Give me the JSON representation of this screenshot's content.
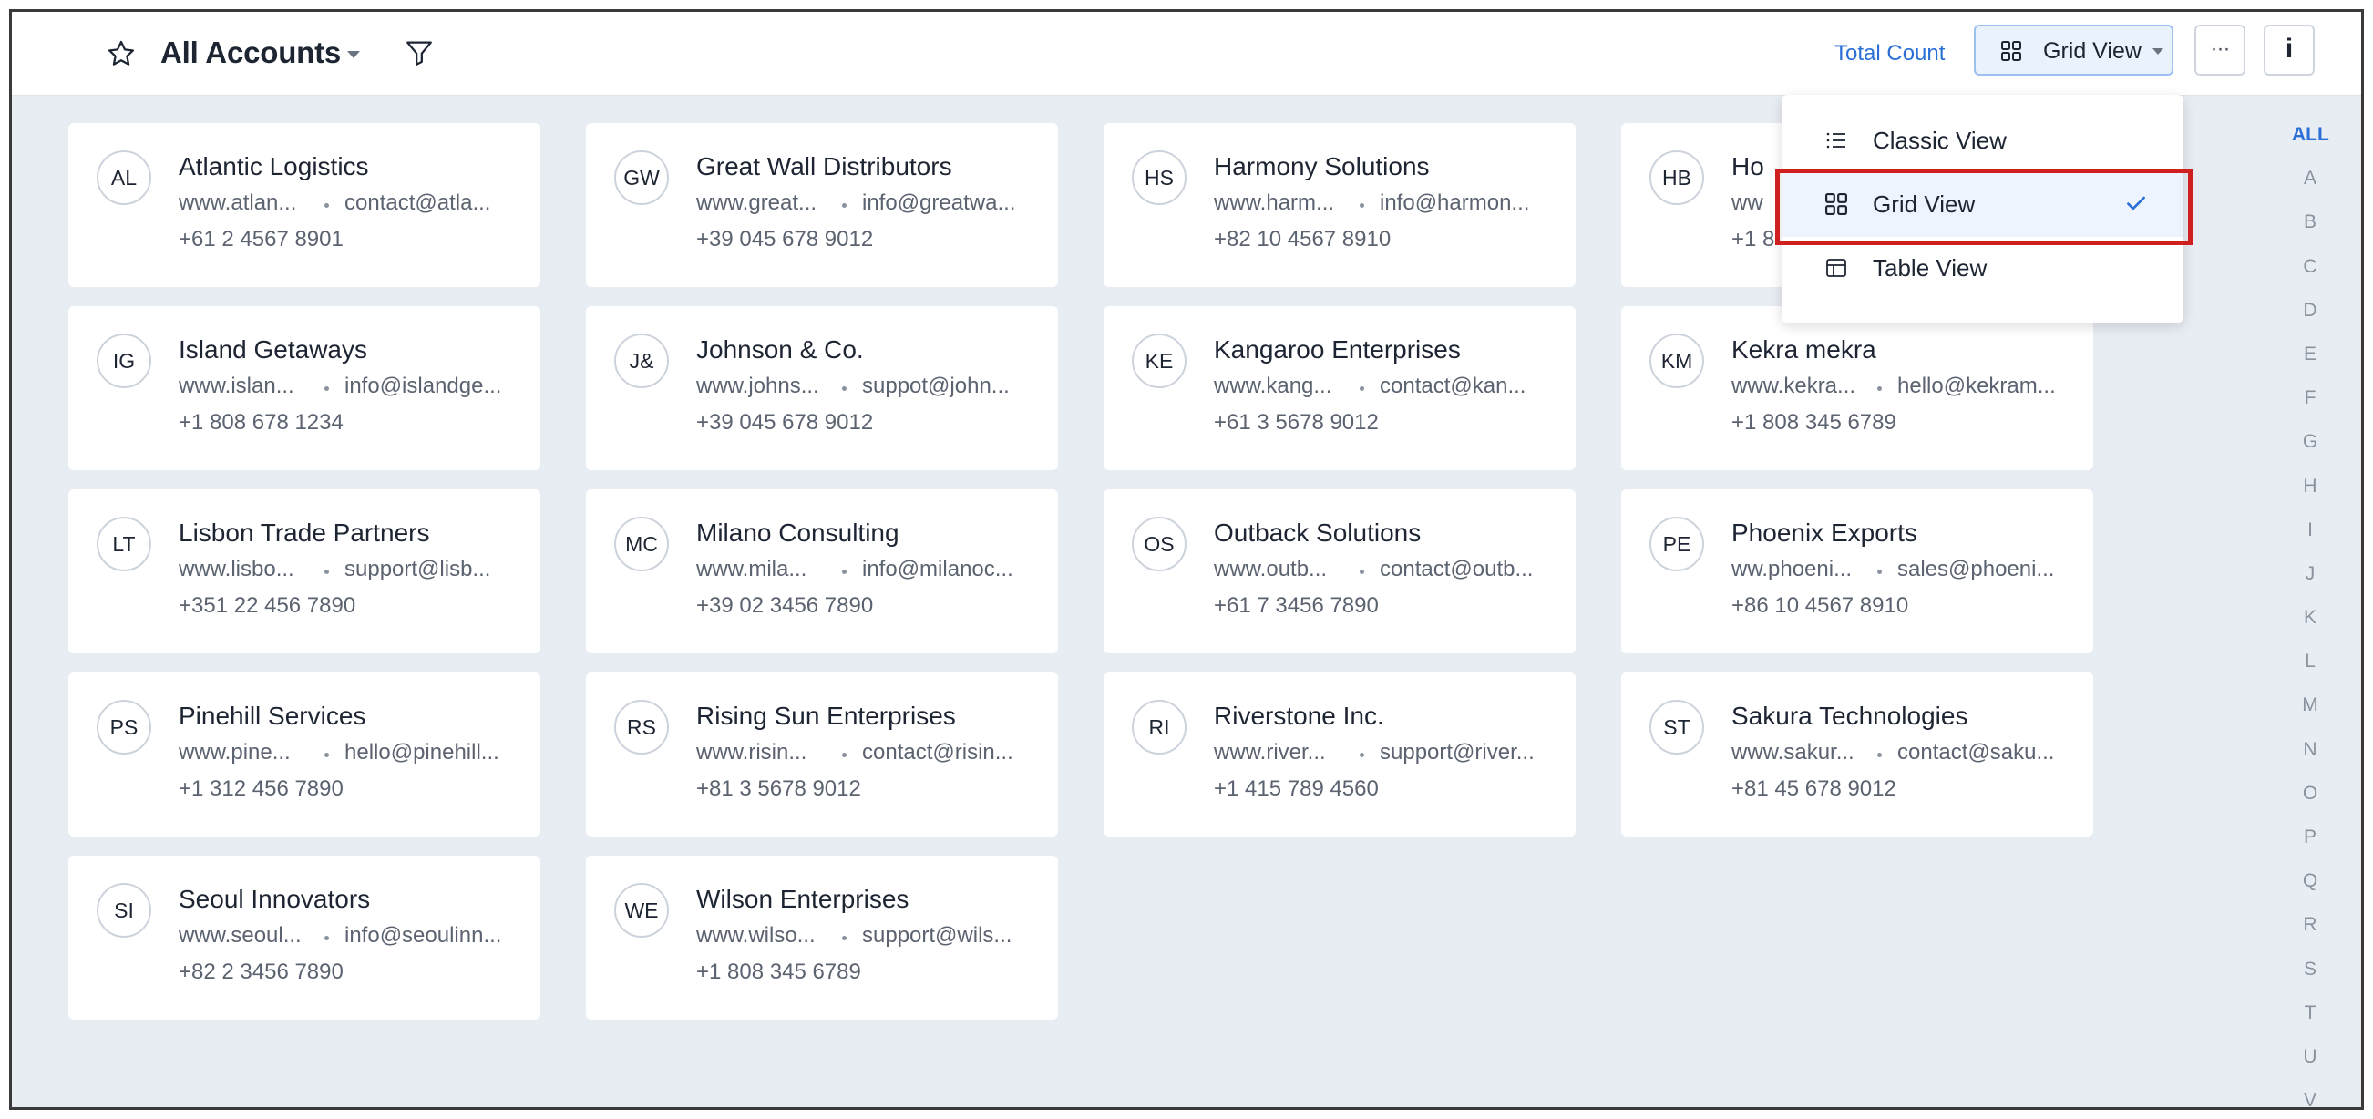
{
  "header": {
    "title": "All Accounts",
    "total_count_label": "Total Count",
    "view_button_label": "Grid View",
    "more_button_label": "···",
    "info_button_label": "i"
  },
  "icons": {
    "favorite": "star-icon",
    "filter": "filter-icon",
    "view": "grid-icon",
    "more": "ellipsis-icon",
    "info": "info-icon"
  },
  "view_menu": {
    "items": [
      {
        "label": "Classic View",
        "icon": "list-icon",
        "selected": false
      },
      {
        "label": "Grid View",
        "icon": "grid-icon",
        "selected": true
      },
      {
        "label": "Table View",
        "icon": "table-icon",
        "selected": false
      }
    ]
  },
  "accounts": [
    {
      "initials": "AL",
      "name": "Atlantic Logistics",
      "website": "www.atlan...",
      "email": "contact@atla...",
      "phone": "+61 2 4567 8901"
    },
    {
      "initials": "GW",
      "name": "Great Wall Distributors",
      "website": "www.great...",
      "email": "info@greatwa...",
      "phone": "+39 045 678 9012"
    },
    {
      "initials": "HS",
      "name": "Harmony Solutions",
      "website": "www.harm...",
      "email": "info@harmon...",
      "phone": "+82 10 4567 8910"
    },
    {
      "initials": "HB",
      "name": "Ho",
      "website": "ww",
      "email": "",
      "phone": "+1 8"
    },
    {
      "initials": "IG",
      "name": "Island Getaways",
      "website": "www.islan...",
      "email": "info@islandge...",
      "phone": "+1 808 678 1234"
    },
    {
      "initials": "J&",
      "name": "Johnson & Co.",
      "website": "www.johns...",
      "email": "suppot@john...",
      "phone": "+39 045 678 9012"
    },
    {
      "initials": "KE",
      "name": "Kangaroo Enterprises",
      "website": "www.kang...",
      "email": "contact@kan...",
      "phone": "+61 3 5678 9012"
    },
    {
      "initials": "KM",
      "name": "Kekra mekra",
      "website": "www.kekra...",
      "email": "hello@kekram...",
      "phone": "+1 808 345 6789"
    },
    {
      "initials": "LT",
      "name": "Lisbon Trade Partners",
      "website": "www.lisbo...",
      "email": "support@lisb...",
      "phone": "+351 22 456 7890"
    },
    {
      "initials": "MC",
      "name": "Milano Consulting",
      "website": "www.mila...",
      "email": "info@milanoc...",
      "phone": "+39 02 3456 7890"
    },
    {
      "initials": "OS",
      "name": "Outback Solutions",
      "website": "www.outb...",
      "email": "contact@outb...",
      "phone": "+61 7 3456 7890"
    },
    {
      "initials": "PE",
      "name": "Phoenix Exports",
      "website": "ww.phoeni...",
      "email": "sales@phoeni...",
      "phone": "+86 10 4567 8910"
    },
    {
      "initials": "PS",
      "name": "Pinehill Services",
      "website": "www.pine...",
      "email": "hello@pinehill...",
      "phone": "+1 312 456 7890"
    },
    {
      "initials": "RS",
      "name": "Rising Sun Enterprises",
      "website": "www.risin...",
      "email": "contact@risin...",
      "phone": "+81 3 5678 9012"
    },
    {
      "initials": "RI",
      "name": "Riverstone Inc.",
      "website": "www.river...",
      "email": "support@river...",
      "phone": "+1 415 789 4560"
    },
    {
      "initials": "ST",
      "name": "Sakura Technologies",
      "website": "www.sakur...",
      "email": "contact@saku...",
      "phone": "+81 45 678 9012"
    },
    {
      "initials": "SI",
      "name": "Seoul Innovators",
      "website": "www.seoul...",
      "email": "info@seoulinn...",
      "phone": "+82 2 3456 7890"
    },
    {
      "initials": "WE",
      "name": "Wilson Enterprises",
      "website": "www.wilso...",
      "email": "support@wils...",
      "phone": "+1 808 345 6789"
    }
  ],
  "alphabet": [
    "ALL",
    "A",
    "B",
    "C",
    "D",
    "E",
    "F",
    "G",
    "H",
    "I",
    "J",
    "K",
    "L",
    "M",
    "N",
    "O",
    "P",
    "Q",
    "R",
    "S",
    "T",
    "U",
    "V"
  ],
  "colors": {
    "accent": "#2a6fd6",
    "highlight": "#d01f1f",
    "background": "#e8ecf3"
  }
}
